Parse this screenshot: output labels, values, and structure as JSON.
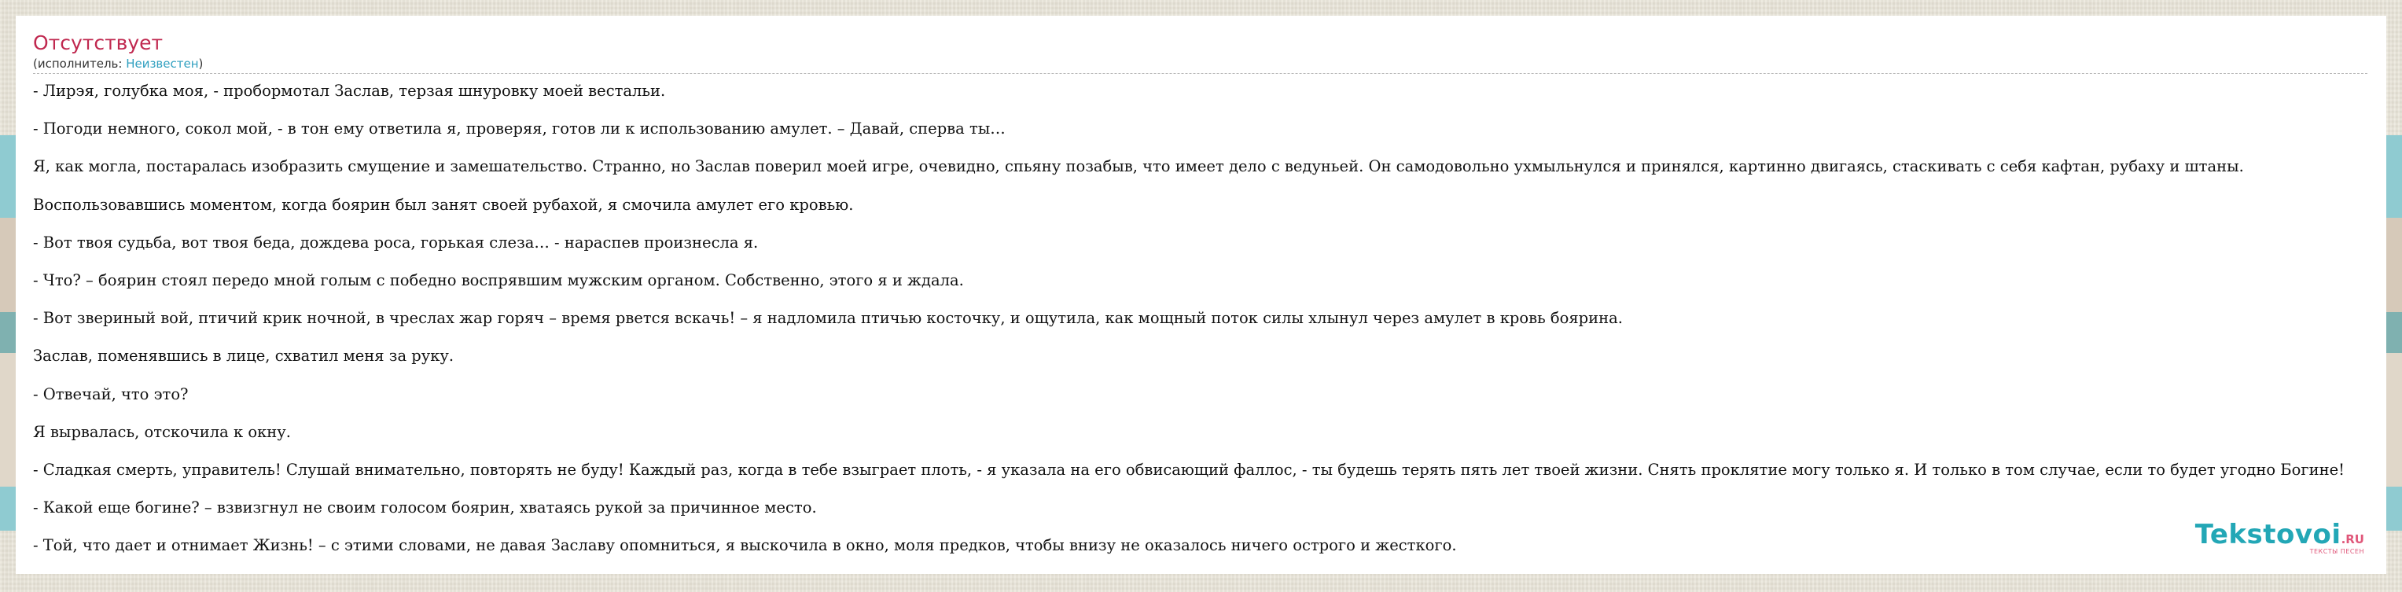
{
  "song": {
    "title": "Отсутствует",
    "performer_prefix": "(исполнитель: ",
    "performer_name": "Неизвестен",
    "performer_suffix": ")"
  },
  "lyrics": [
    "- Лирэя, голубка моя, - пробормотал Заслав, терзая шнуровку моей вестальи.",
    "- Погоди немного, сокол мой, - в тон ему ответила я, проверяя, готов ли к использованию амулет. – Давай, сперва ты…",
    "Я, как могла, постаралась изобразить смущение и замешательство. Странно, но Заслав поверил моей игре, очевидно, спьяну позабыв, что имеет дело с ведуньей. Он самодовольно ухмыльнулся и принялся, картинно двигаясь, стаскивать с себя кафтан, рубаху и штаны.",
    "Воспользовавшись моментом, когда боярин был занят своей рубахой, я смочила амулет его кровью.",
    "- Вот твоя судьба, вот твоя беда, дождева роса, горькая слеза… - нараспев произнесла я.",
    "- Что? – боярин стоял передо мной голым с победно воспрявшим мужским органом. Собственно, этого я и ждала.",
    "- Вот звериный вой, птичий крик ночной,  в чреслах жар горяч – время рвется вскачь! – я надломила птичью косточку, и ощутила, как мощный поток силы хлынул через амулет в кровь боярина.",
    "Заслав, поменявшись в лице, схватил меня за руку.",
    "- Отвечай, что это?",
    "Я вырвалась, отскочила к окну.",
    "- Сладкая смерть, управитель! Слушай внимательно, повторять не буду! Каждый раз, когда в тебе взыграет плоть, - я указала на его обвисающий фаллос, - ты будешь терять пять лет твоей жизни. Снять проклятие могу только я. И только в том случае, если то будет угодно Богине!",
    "- Какой еще богине? – взвизгнул не своим голосом боярин, хватаясь рукой за причинное место.",
    "- Той, что дает и отнимает Жизнь! – с этими словами, не давая Заславу опомниться, я выскочила в окно, моля предков, чтобы внизу не оказалось ничего острого и жесткого."
  ],
  "logo": {
    "name": "Tekstovoi",
    "tld": ".RU",
    "tagline": "ТЕКСТЫ ПЕСЕН"
  },
  "colors": {
    "title": "#c0284f",
    "link": "#2f9fbf",
    "logo_main": "#23a7b6",
    "logo_accent": "#e0577a"
  }
}
